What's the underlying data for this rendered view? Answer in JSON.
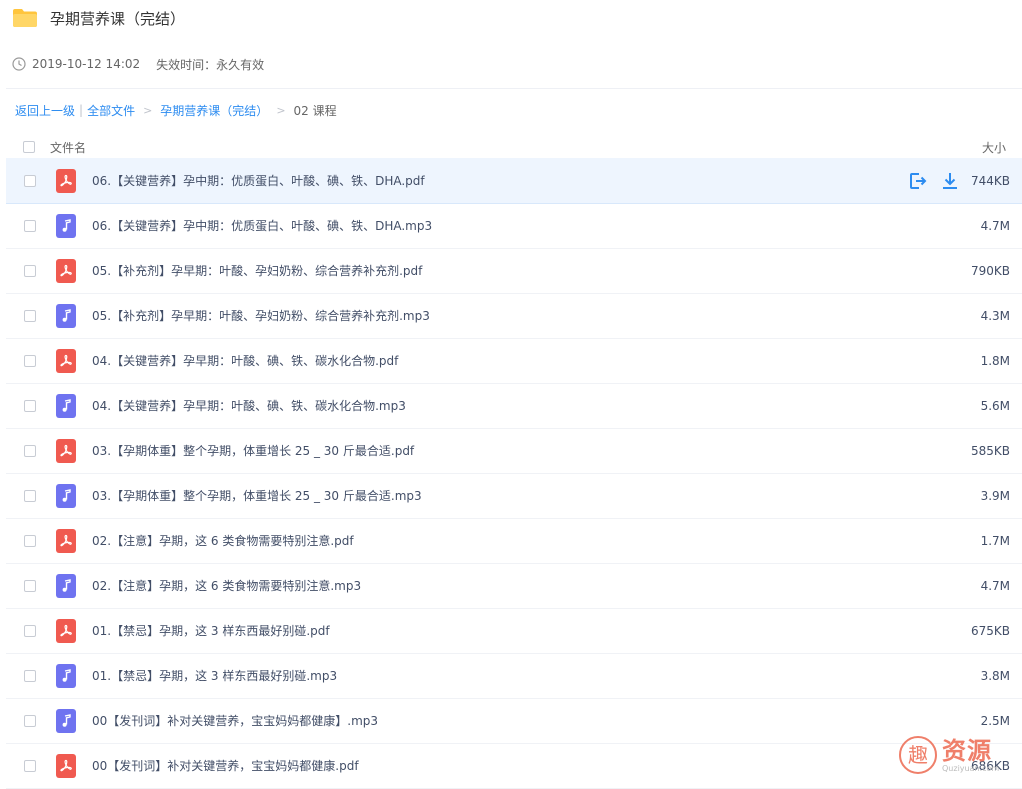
{
  "folder": {
    "title": "孕期营养课（完结）",
    "timestamp": "2019-10-12 14:02",
    "expiry": "失效时间：永久有效"
  },
  "breadcrumb": {
    "back": "返回上一级",
    "all_files": "全部文件",
    "parent": "孕期营养课（完结）",
    "current": "02 课程"
  },
  "list_header": {
    "name": "文件名",
    "size": "大小"
  },
  "files": [
    {
      "type": "pdf",
      "name": "06.【关键营养】孕中期：优质蛋白、叶酸、碘、铁、DHA.pdf",
      "size": "744KB",
      "active": true
    },
    {
      "type": "mp3",
      "name": "06.【关键营养】孕中期：优质蛋白、叶酸、碘、铁、DHA.mp3",
      "size": "4.7M"
    },
    {
      "type": "pdf",
      "name": "05.【补充剂】孕早期：叶酸、孕妇奶粉、综合营养补充剂.pdf",
      "size": "790KB"
    },
    {
      "type": "mp3",
      "name": "05.【补充剂】孕早期：叶酸、孕妇奶粉、综合营养补充剂.mp3",
      "size": "4.3M"
    },
    {
      "type": "pdf",
      "name": "04.【关键营养】孕早期：叶酸、碘、铁、碳水化合物.pdf",
      "size": "1.8M"
    },
    {
      "type": "mp3",
      "name": "04.【关键营养】孕早期：叶酸、碘、铁、碳水化合物.mp3",
      "size": "5.6M"
    },
    {
      "type": "pdf",
      "name": "03.【孕期体重】整个孕期，体重增长 25 _ 30 斤最合适.pdf",
      "size": "585KB"
    },
    {
      "type": "mp3",
      "name": "03.【孕期体重】整个孕期，体重增长 25 _ 30 斤最合适.mp3",
      "size": "3.9M"
    },
    {
      "type": "pdf",
      "name": "02.【注意】孕期，这 6 类食物需要特别注意.pdf",
      "size": "1.7M"
    },
    {
      "type": "mp3",
      "name": "02.【注意】孕期，这 6 类食物需要特别注意.mp3",
      "size": "4.7M"
    },
    {
      "type": "pdf",
      "name": "01.【禁忌】孕期，这 3 样东西最好别碰.pdf",
      "size": "675KB"
    },
    {
      "type": "mp3",
      "name": "01.【禁忌】孕期，这 3 样东西最好别碰.mp3",
      "size": "3.8M"
    },
    {
      "type": "mp3",
      "name": "00【发刊词】补对关键营养，宝宝妈妈都健康】.mp3",
      "size": "2.5M"
    },
    {
      "type": "pdf",
      "name": "00【发刊词】补对关键营养，宝宝妈妈都健康.pdf",
      "size": "686KB"
    }
  ],
  "icons": {
    "folder": "folder-icon",
    "clock": "clock-icon",
    "pdf": "pdf-file-icon",
    "mp3": "music-file-icon",
    "save": "save-to-drive-icon",
    "download": "download-icon"
  },
  "colors": {
    "link": "#2d8cf0",
    "pdf": "#f05a50",
    "mp3": "#6f73f0",
    "folder": "#ffc53d",
    "active_row": "#eef5fe"
  },
  "watermark": {
    "logo_char": "趣",
    "text": "资源",
    "url": "Quziyuan.com"
  }
}
